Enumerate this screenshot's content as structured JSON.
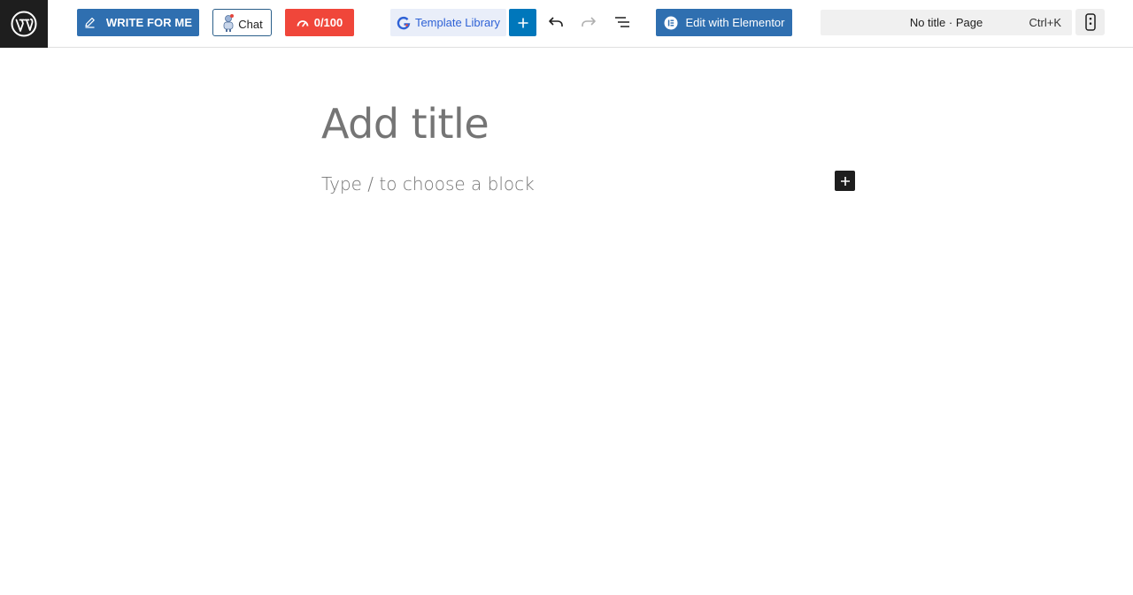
{
  "toolbar": {
    "write_label": "WRITE FOR ME",
    "chat_label": "Chat",
    "score_label": "0/100",
    "template_label": "Template Library",
    "elementor_label": "Edit with Elementor"
  },
  "command_bar": {
    "title": "No title · Page",
    "shortcut": "Ctrl+K"
  },
  "editor": {
    "title_placeholder": "Add title",
    "block_placeholder": "Type / to choose a block"
  },
  "colors": {
    "wp_dark": "#1e1e1e",
    "write_blue": "#2f6fb0",
    "score_red": "#f0463a",
    "template_bg": "#e9eef9",
    "template_text": "#2f62d6",
    "add_blue": "#0077bb",
    "placeholder_gray": "#757575"
  },
  "icons": {
    "logo": "wordpress-logo-icon",
    "write": "pencil-icon",
    "chat": "robot-avatar-icon",
    "score": "gauge-icon",
    "template": "template-g-icon",
    "add": "plus-icon",
    "undo": "undo-icon",
    "redo": "redo-icon",
    "outline": "document-overview-icon",
    "elementor": "elementor-icon",
    "device": "device-preview-icon",
    "inserter": "plus-icon"
  }
}
